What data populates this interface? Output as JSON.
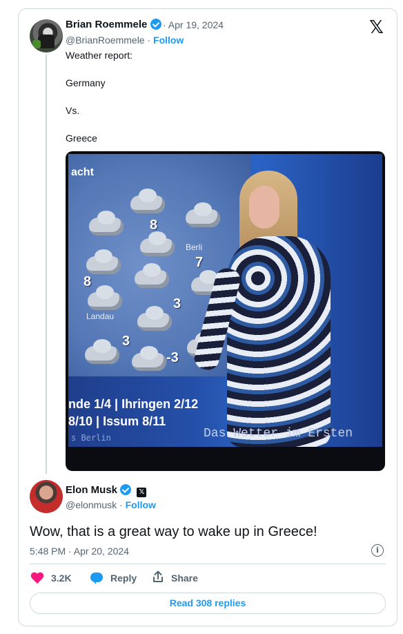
{
  "quoted_tweet": {
    "author_name": "Brian Roemmele",
    "date": "· Apr 19, 2024",
    "handle": "@BrianRoemmele",
    "handle_separator": "·",
    "follow_label": "Follow",
    "body_lines": [
      "Weather report:",
      "Germany",
      "Vs.",
      "Greece"
    ],
    "media": {
      "map_title": "acht",
      "temperatures": [
        "8",
        "8",
        "7",
        "3",
        "3",
        "-3"
      ],
      "cities": [
        "Berli",
        "Landau"
      ],
      "ticker_line_1": "nde 1/4 | Ihringen 2/12",
      "ticker_line_2": "8/10 | Issum 8/11",
      "ticker_line_3": "s Berlin",
      "broadcast_brand": "Das Wetter im Ersten"
    }
  },
  "main_tweet": {
    "author_name": "Elon Musk",
    "handle": "@elonmusk",
    "handle_separator": "·",
    "follow_label": "Follow",
    "text": "Wow, that is a great way to wake up in Greece!",
    "timestamp": "5:48 PM · Apr 20, 2024",
    "likes": "3.2K",
    "reply_label": "Reply",
    "share_label": "Share",
    "read_replies_label": "Read 308 replies"
  },
  "icons": {
    "verified": "verified-badge-icon",
    "x_logo": "x-logo-icon",
    "info": "info-icon",
    "heart": "heart-icon",
    "reply": "reply-bubble-icon",
    "share": "share-icon"
  },
  "colors": {
    "accent": "#1d9bf0",
    "like": "#f91880",
    "muted": "#536471",
    "border": "#cfd9de"
  }
}
